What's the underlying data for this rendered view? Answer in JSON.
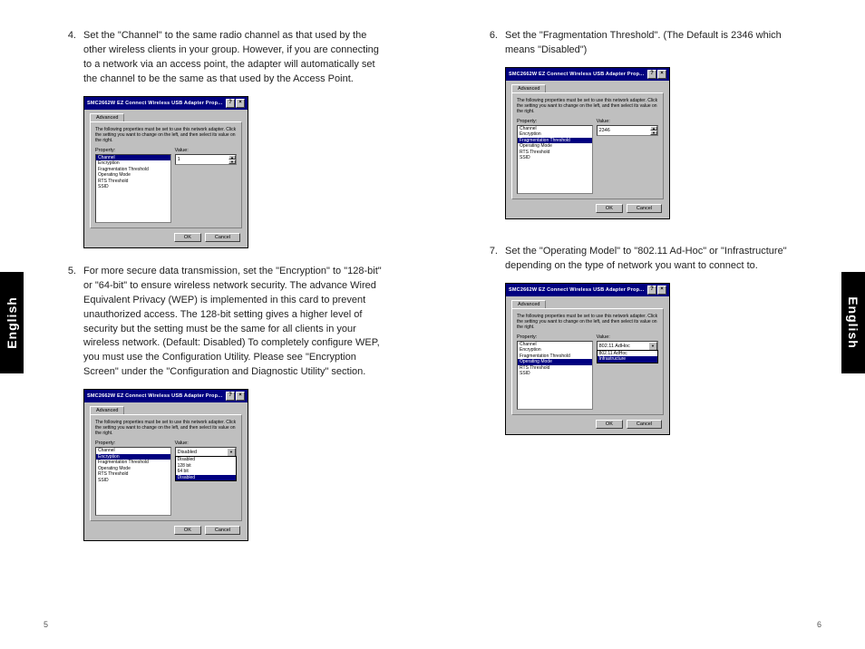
{
  "tabs": {
    "left": "English",
    "right": "English"
  },
  "pagenum": {
    "left": "5",
    "right": "6"
  },
  "dialog": {
    "title": "SMC2662W EZ Connect Wireless USB Adapter Prop...",
    "tab": "Advanced",
    "instr": "The following properties must be set to use this network adapter. Click the setting you want to change on the left, and then select its value on the right.",
    "propLabel": "Property:",
    "valLabel": "Value:",
    "ok": "OK",
    "cancel": "Cancel",
    "props": {
      "channel": "Channel",
      "encryption": "Encryption",
      "frag": "Fragmentation Threshold",
      "mode": "Operating Mode",
      "rts": "RTS Threshold",
      "ssid": "SSID"
    }
  },
  "d1": {
    "selected": "Channel",
    "value": "1"
  },
  "d2": {
    "selected": "Encryption",
    "value": "Disabled",
    "options": {
      "o1": "Disabled",
      "o2": "128 bit",
      "o3": "64 bit",
      "sel": "Disabled"
    }
  },
  "d3": {
    "selected": "Fragmentation Threshold",
    "value": "2346"
  },
  "d4": {
    "selected": "Operating Mode",
    "value": "802.11 AdHoc",
    "options": {
      "o1": "802.11 AdHoc",
      "sel": "Infrastructure"
    }
  },
  "items": {
    "i4": {
      "n": "4.",
      "t": "Set the \"Channel\" to the same radio channel as that used by the other wireless clients in your group. However, if you are connecting to a network via an access point, the adapter will automatically set the channel to be the same as that used by the Access Point."
    },
    "i5": {
      "n": "5.",
      "t": "For more secure data transmission, set the \"Encryption\" to \"128-bit\" or \"64-bit\" to ensure wireless network security. The advance Wired Equivalent Privacy (WEP) is implemented in this card to prevent unauthorized access. The 128-bit setting gives a higher level of security but the setting must be the same for all clients in your wireless network. (Default: Disabled) To completely configure WEP, you must use the Configuration Utility. Please see \"Encryption Screen\" under the \"Configuration and Diagnostic Utility\" section."
    },
    "i6": {
      "n": "6.",
      "t": "Set the \"Fragmentation Threshold\". (The Default is 2346 which means \"Disabled\")"
    },
    "i7": {
      "n": "7.",
      "t": "Set the \"Operating Model\" to \"802.11 Ad-Hoc\" or \"Infrastructure\" depending on the type of network you want to connect to."
    }
  }
}
